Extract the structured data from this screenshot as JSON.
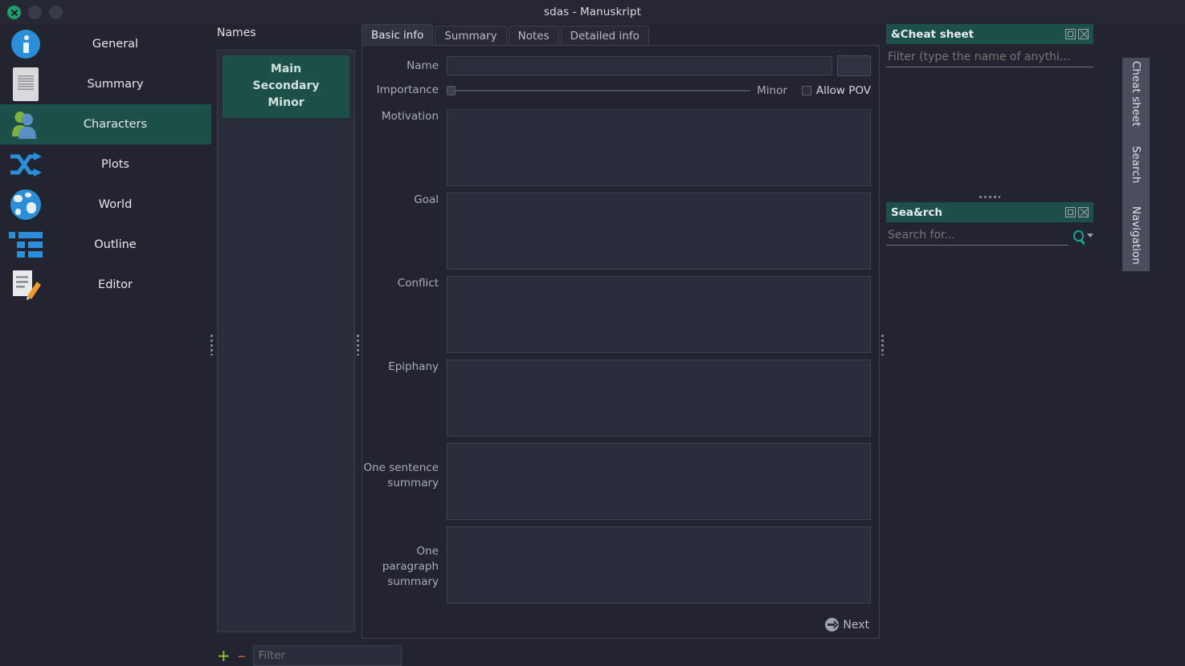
{
  "window": {
    "title": "sdas - Manuskript",
    "controls": [
      "close",
      "minimize",
      "maximize"
    ]
  },
  "sidebar": {
    "items": [
      {
        "label": "General",
        "icon": "info-icon",
        "active": false
      },
      {
        "label": "Summary",
        "icon": "document-icon",
        "active": false
      },
      {
        "label": "Characters",
        "icon": "people-icon",
        "active": true
      },
      {
        "label": "Plots",
        "icon": "shuffle-icon",
        "active": false
      },
      {
        "label": "World",
        "icon": "globe-icon",
        "active": false
      },
      {
        "label": "Outline",
        "icon": "list-icon",
        "active": false
      },
      {
        "label": "Editor",
        "icon": "edit-doc-icon",
        "active": false
      }
    ]
  },
  "names_panel": {
    "title": "Names",
    "items": [
      {
        "lines": [
          "Main",
          "Secondary",
          "Minor"
        ],
        "selected": true
      }
    ],
    "add_label": "+",
    "remove_label": "–",
    "filter_placeholder": "Filter",
    "filter_value": ""
  },
  "center": {
    "tabs": [
      {
        "label": "Basic info",
        "active": true
      },
      {
        "label": "Summary",
        "active": false
      },
      {
        "label": "Notes",
        "active": false
      },
      {
        "label": "Detailed info",
        "active": false
      }
    ],
    "fields": {
      "name_label": "Name",
      "name_value": "",
      "importance_label": "Importance",
      "importance_value": "Minor",
      "allow_pov_label": "Allow POV",
      "allow_pov_checked": false,
      "motivation_label": "Motivation",
      "motivation_value": "",
      "goal_label": "Goal",
      "goal_value": "",
      "conflict_label": "Conflict",
      "conflict_value": "",
      "epiphany_label": "Epiphany",
      "epiphany_value": "",
      "one_sentence_label": "One sentence summary",
      "one_sentence_value": "",
      "one_paragraph_label": "One paragraph summary",
      "one_paragraph_value": ""
    },
    "next_label": "Next"
  },
  "dock": {
    "cheat_sheet": {
      "title": "&Cheat sheet",
      "filter_placeholder": "Filter (type the name of anythi…",
      "filter_value": ""
    },
    "search": {
      "title": "Sea&rch",
      "input_placeholder": "Search for...",
      "input_value": ""
    },
    "vertical_tabs": [
      "Cheat sheet",
      "Search",
      "Navigation"
    ]
  },
  "colors": {
    "accent_teal": "#1d5049",
    "background": "#22252f",
    "field_fill": "#2a2d3a",
    "icon_blue": "#2a8fd8",
    "add_green": "#9acd32",
    "remove_red": "#e05c4a",
    "search_teal": "#18a08c"
  }
}
